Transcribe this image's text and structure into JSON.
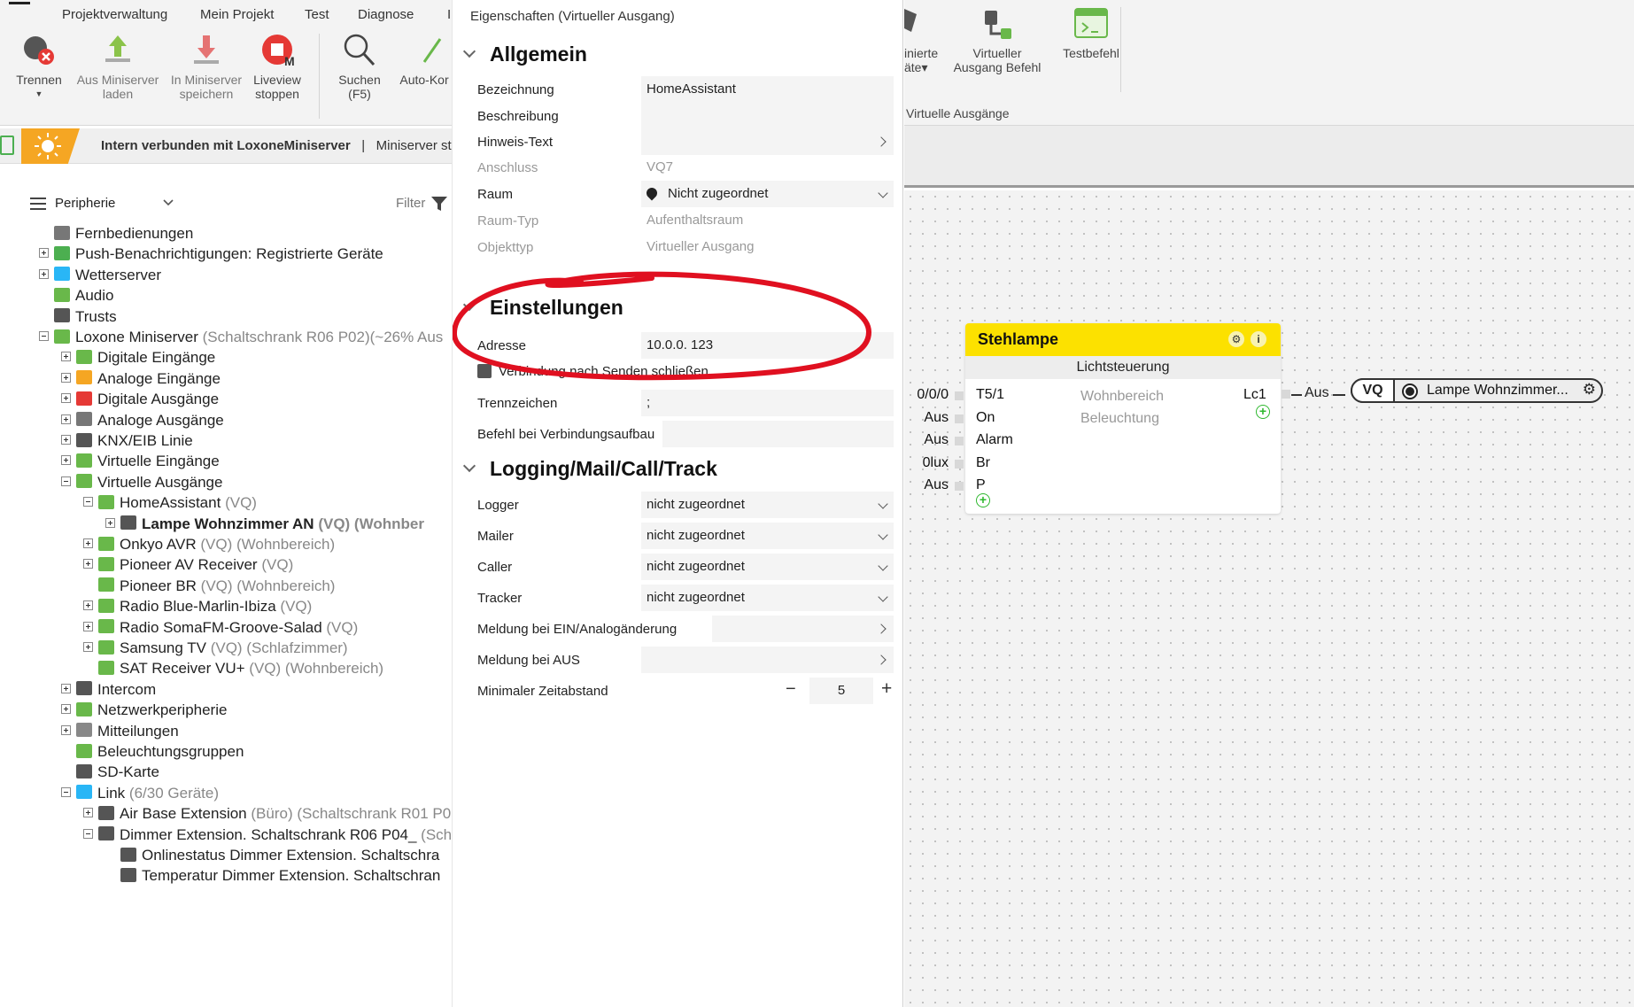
{
  "menu": [
    "Projektverwaltung",
    "Mein Projekt",
    "Test",
    "Diagnose",
    "I"
  ],
  "ribbon_left": [
    {
      "label": "Trennen",
      "icon": "disconnect-icon"
    },
    {
      "label": "Aus Miniserver\nladen",
      "icon": "upload-icon"
    },
    {
      "label": "In Miniserver\nspeichern",
      "icon": "download-icon"
    },
    {
      "label": "Liveview\nstoppen",
      "icon": "liveview-stop-icon"
    },
    {
      "label": "Suchen\n(F5)",
      "icon": "search-icon"
    },
    {
      "label": "Auto-Kor",
      "icon": "auto-config-icon"
    }
  ],
  "status": {
    "bold": "Intern verbunden mit LoxoneMiniserver",
    "sep": "|",
    "rest": "Miniserver st"
  },
  "tree_header": {
    "title": "Peripherie",
    "filter": "Filter"
  },
  "tree": [
    {
      "label": "Fernbedienungen",
      "sub": "",
      "level": 1,
      "exp": "none",
      "color": "#777"
    },
    {
      "label": "Push-Benachrichtigungen: Registrierte Geräte",
      "sub": "",
      "level": 1,
      "exp": "plus",
      "color": "#4caf50"
    },
    {
      "label": "Wetterserver",
      "sub": "",
      "level": 1,
      "exp": "plus",
      "color": "#29b6f6"
    },
    {
      "label": "Audio",
      "sub": "",
      "level": 1,
      "exp": "none",
      "color": "#69b84a"
    },
    {
      "label": "Trusts",
      "sub": "",
      "level": 1,
      "exp": "none",
      "color": "#555"
    },
    {
      "label": "Loxone Miniserver",
      "sub": "(Schaltschrank R06 P02)(~26% Aus",
      "level": 1,
      "exp": "minus",
      "color": "#69b84a"
    },
    {
      "label": "Digitale Eingänge",
      "sub": "",
      "level": 2,
      "exp": "plus",
      "color": "#69b84a"
    },
    {
      "label": "Analoge Eingänge",
      "sub": "",
      "level": 2,
      "exp": "plus",
      "color": "#f5a623"
    },
    {
      "label": "Digitale Ausgänge",
      "sub": "",
      "level": 2,
      "exp": "plus",
      "color": "#e53935"
    },
    {
      "label": "Analoge Ausgänge",
      "sub": "",
      "level": 2,
      "exp": "plus",
      "color": "#777"
    },
    {
      "label": "KNX/EIB Linie",
      "sub": "",
      "level": 2,
      "exp": "plus",
      "color": "#555"
    },
    {
      "label": "Virtuelle Eingänge",
      "sub": "",
      "level": 2,
      "exp": "plus",
      "color": "#69b84a"
    },
    {
      "label": "Virtuelle Ausgänge",
      "sub": "",
      "level": 2,
      "exp": "minus",
      "color": "#69b84a"
    },
    {
      "label": "HomeAssistant",
      "sub": "(VQ)",
      "level": 3,
      "exp": "minus",
      "color": "#69b84a"
    },
    {
      "label": "Lampe Wohnzimmer AN",
      "sub": "(VQ) (Wohnber",
      "level": 4,
      "exp": "plus",
      "color": "#555",
      "bold": true
    },
    {
      "label": "Onkyo AVR",
      "sub": "(VQ) (Wohnbereich)",
      "level": 3,
      "exp": "plus",
      "color": "#69b84a"
    },
    {
      "label": "Pioneer AV Receiver",
      "sub": "(VQ)",
      "level": 3,
      "exp": "plus",
      "color": "#69b84a"
    },
    {
      "label": "Pioneer BR",
      "sub": "(VQ) (Wohnbereich)",
      "level": 3,
      "exp": "none",
      "color": "#69b84a"
    },
    {
      "label": "Radio Blue-Marlin-Ibiza",
      "sub": "(VQ)",
      "level": 3,
      "exp": "plus",
      "color": "#69b84a"
    },
    {
      "label": "Radio SomaFM-Groove-Salad",
      "sub": "(VQ)",
      "level": 3,
      "exp": "plus",
      "color": "#69b84a"
    },
    {
      "label": "Samsung TV",
      "sub": "(VQ) (Schlafzimmer)",
      "level": 3,
      "exp": "plus",
      "color": "#69b84a"
    },
    {
      "label": "SAT Receiver VU+",
      "sub": "(VQ) (Wohnbereich)",
      "level": 3,
      "exp": "none",
      "color": "#69b84a"
    },
    {
      "label": "Intercom",
      "sub": "",
      "level": 2,
      "exp": "plus",
      "color": "#555"
    },
    {
      "label": "Netzwerkperipherie",
      "sub": "",
      "level": 2,
      "exp": "plus",
      "color": "#69b84a"
    },
    {
      "label": "Mitteilungen",
      "sub": "",
      "level": 2,
      "exp": "plus",
      "color": "#888"
    },
    {
      "label": "Beleuchtungsgruppen",
      "sub": "",
      "level": 2,
      "exp": "none",
      "color": "#69b84a"
    },
    {
      "label": "SD-Karte",
      "sub": "",
      "level": 2,
      "exp": "none",
      "color": "#555"
    },
    {
      "label": "Link",
      "sub": "(6/30 Geräte)",
      "level": 2,
      "exp": "minus",
      "color": "#29b6f6"
    },
    {
      "label": "Air Base Extension",
      "sub": "(Büro) (Schaltschrank R01 P0",
      "level": 3,
      "exp": "plus",
      "color": "#555"
    },
    {
      "label": "Dimmer Extension. Schaltschrank R06 P04_",
      "sub": "(Sch",
      "level": 3,
      "exp": "minus",
      "color": "#555"
    },
    {
      "label": "Onlinestatus Dimmer Extension. Schaltschra",
      "sub": "",
      "level": 4,
      "exp": "none",
      "color": "#555"
    },
    {
      "label": "Temperatur Dimmer Extension. Schaltschran",
      "sub": "",
      "level": 4,
      "exp": "none",
      "color": "#555"
    }
  ],
  "props": {
    "title": "Eigenschaften (Virtueller Ausgang)",
    "sections": {
      "allgemein": "Allgemein",
      "einstellungen": "Einstellungen",
      "logging": "Logging/Mail/Call/Track"
    },
    "allgemein": [
      {
        "label": "Bezeichnung",
        "value": "HomeAssistant"
      },
      {
        "label": "Beschreibung",
        "value": ""
      },
      {
        "label": "Hinweis-Text",
        "value": ""
      },
      {
        "label": "Anschluss",
        "value": "VQ7"
      },
      {
        "label": "Raum",
        "value": "Nicht zugeordnet"
      },
      {
        "label": "Raum-Typ",
        "value": "Aufenthaltsraum"
      },
      {
        "label": "Objekttyp",
        "value": "Virtueller Ausgang"
      }
    ],
    "einstellungen": [
      {
        "label": "Adresse",
        "value": "10.0.0.   123"
      },
      {
        "label": "Verbindung nach Senden schließen",
        "value": ""
      },
      {
        "label": "Trennzeichen",
        "value": ";"
      },
      {
        "label": "Befehl bei Verbindungsaufbau",
        "value": ""
      }
    ],
    "logging": [
      {
        "label": "Logger",
        "value": "nicht zugeordnet"
      },
      {
        "label": "Mailer",
        "value": "nicht zugeordnet"
      },
      {
        "label": "Caller",
        "value": "nicht zugeordnet"
      },
      {
        "label": "Tracker",
        "value": "nicht zugeordnet"
      },
      {
        "label": "Meldung bei EIN/Analogänderung",
        "value": ""
      },
      {
        "label": "Meldung bei AUS",
        "value": ""
      },
      {
        "label": "Minimaler Zeitabstand",
        "value": "5",
        "minus": "−",
        "plus": "+"
      }
    ]
  },
  "ribbon_right": [
    {
      "label": "inierte\näte▾",
      "icon": "defined-icon"
    },
    {
      "label": "Virtueller\nAusgang Befehl",
      "icon": "virtual-output-command-icon"
    },
    {
      "label": "Testbefehl",
      "icon": "test-command-icon"
    }
  ],
  "ribbon_right_group": "Virtuelle Ausgänge",
  "block": {
    "title": "Stehlampe",
    "subtitle": "Lichtsteuerung",
    "inputs_left": [
      "0/0/0",
      "Aus",
      "Aus",
      "0lux",
      "Aus"
    ],
    "ports": [
      "T5/1",
      "On",
      "Alarm",
      "Br",
      "P"
    ],
    "center": [
      "Wohnbereich",
      "Beleuchtung"
    ],
    "output": "Lc1",
    "gear": "⚙",
    "info": "i"
  },
  "connector": {
    "label": "Aus",
    "tag": "VQ",
    "target": "Lampe Wohnzimmer..."
  },
  "colors": {
    "accent_yellow": "#fce100",
    "annotation_red": "#e01020",
    "status_orange": "#f5a623",
    "loxone_green": "#69b84a"
  }
}
